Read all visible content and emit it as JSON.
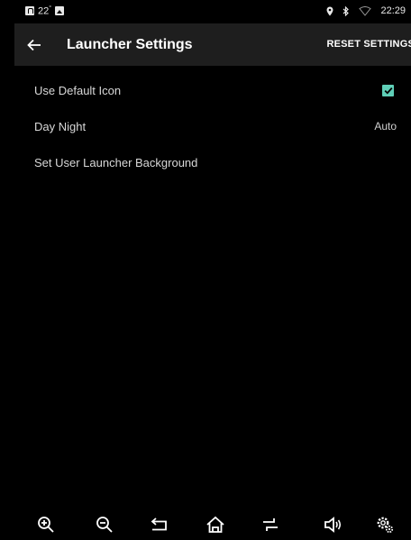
{
  "status_bar": {
    "temperature": "22",
    "temperature_unit": "°",
    "time": "22:29",
    "icons": [
      "notification-a-icon",
      "image-icon",
      "location-icon",
      "bluetooth-icon",
      "wifi-icon"
    ]
  },
  "app_bar": {
    "title": "Launcher Settings",
    "reset_label": "RESET SETTINGS"
  },
  "settings": [
    {
      "label": "Use Default Icon",
      "control": "checkbox",
      "checked": true
    },
    {
      "label": "Day Night",
      "control": "value",
      "value": "Auto"
    },
    {
      "label": "Set User Launcher Background",
      "control": "none"
    }
  ],
  "nav_bar": {
    "icons": [
      "zoom-in-icon",
      "zoom-out-icon",
      "back-icon",
      "home-icon",
      "recent-apps-icon",
      "volume-icon",
      "settings-icon"
    ]
  },
  "colors": {
    "background": "#000000",
    "app_bar": "#1e1e1e",
    "accent": "#5fcfb7"
  }
}
